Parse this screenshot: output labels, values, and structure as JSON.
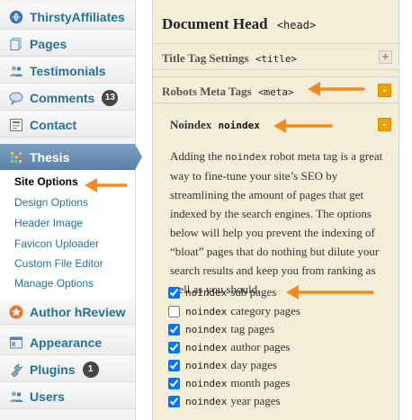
{
  "sidebar": {
    "items": [
      {
        "label": "ThirstyAffiliates",
        "icon": "link-icon"
      },
      {
        "label": "Pages",
        "icon": "pages-icon"
      },
      {
        "label": "Testimonials",
        "icon": "users-icon"
      },
      {
        "label": "Comments",
        "icon": "comment-icon",
        "badge": "13"
      },
      {
        "label": "Contact",
        "icon": "contact-icon"
      }
    ],
    "thesis": {
      "label": "Thesis",
      "icon": "thesis-grid-icon"
    },
    "submenu": [
      {
        "label": "Site Options",
        "current": true
      },
      {
        "label": "Design Options"
      },
      {
        "label": "Header Image"
      },
      {
        "label": "Favicon Uploader"
      },
      {
        "label": "Custom File Editor"
      },
      {
        "label": "Manage Options"
      }
    ],
    "lower_items": [
      {
        "label": "Author hReview",
        "icon": "star-icon"
      },
      {
        "label": "Appearance",
        "icon": "appearance-icon"
      },
      {
        "label": "Plugins",
        "icon": "plugin-icon",
        "badge": "1"
      },
      {
        "label": "Users",
        "icon": "users-icon"
      }
    ]
  },
  "main": {
    "heading": "Document Head",
    "heading_tag": "<head>",
    "title_tag_settings": {
      "label": "Title Tag Settings",
      "tag": "<title>",
      "toggle": "+"
    },
    "robots_meta": {
      "label": "Robots Meta Tags",
      "tag": "<meta>",
      "toggle": "-"
    },
    "noindex": {
      "label": "Noindex",
      "code": "noindex",
      "toggle": "-",
      "desc_before_code": "Adding the ",
      "desc_code": "noindex",
      "desc_after_code": " robot meta tag is a great way to fine-tune your site’s SEO by streamlining the amount of pages that get indexed by the search engines. The options below will help you prevent the indexing of “bloat” pages that do nothing but dilute your search results and keep you from ranking as well as you should."
    },
    "options": [
      {
        "code": "noindex",
        "label": "sub pages",
        "checked": true
      },
      {
        "code": "noindex",
        "label": "category pages",
        "checked": false
      },
      {
        "code": "noindex",
        "label": "tag pages",
        "checked": true
      },
      {
        "code": "noindex",
        "label": "author pages",
        "checked": true
      },
      {
        "code": "noindex",
        "label": "day pages",
        "checked": true
      },
      {
        "code": "noindex",
        "label": "month pages",
        "checked": true
      },
      {
        "code": "noindex",
        "label": "year pages",
        "checked": true
      }
    ]
  },
  "colors": {
    "link": "#21759b",
    "thesis_active": "#6b8fb5",
    "panel_bg": "#f4eed9",
    "toggle_orange": "#f0a100",
    "arrow": "#f58a1f"
  }
}
